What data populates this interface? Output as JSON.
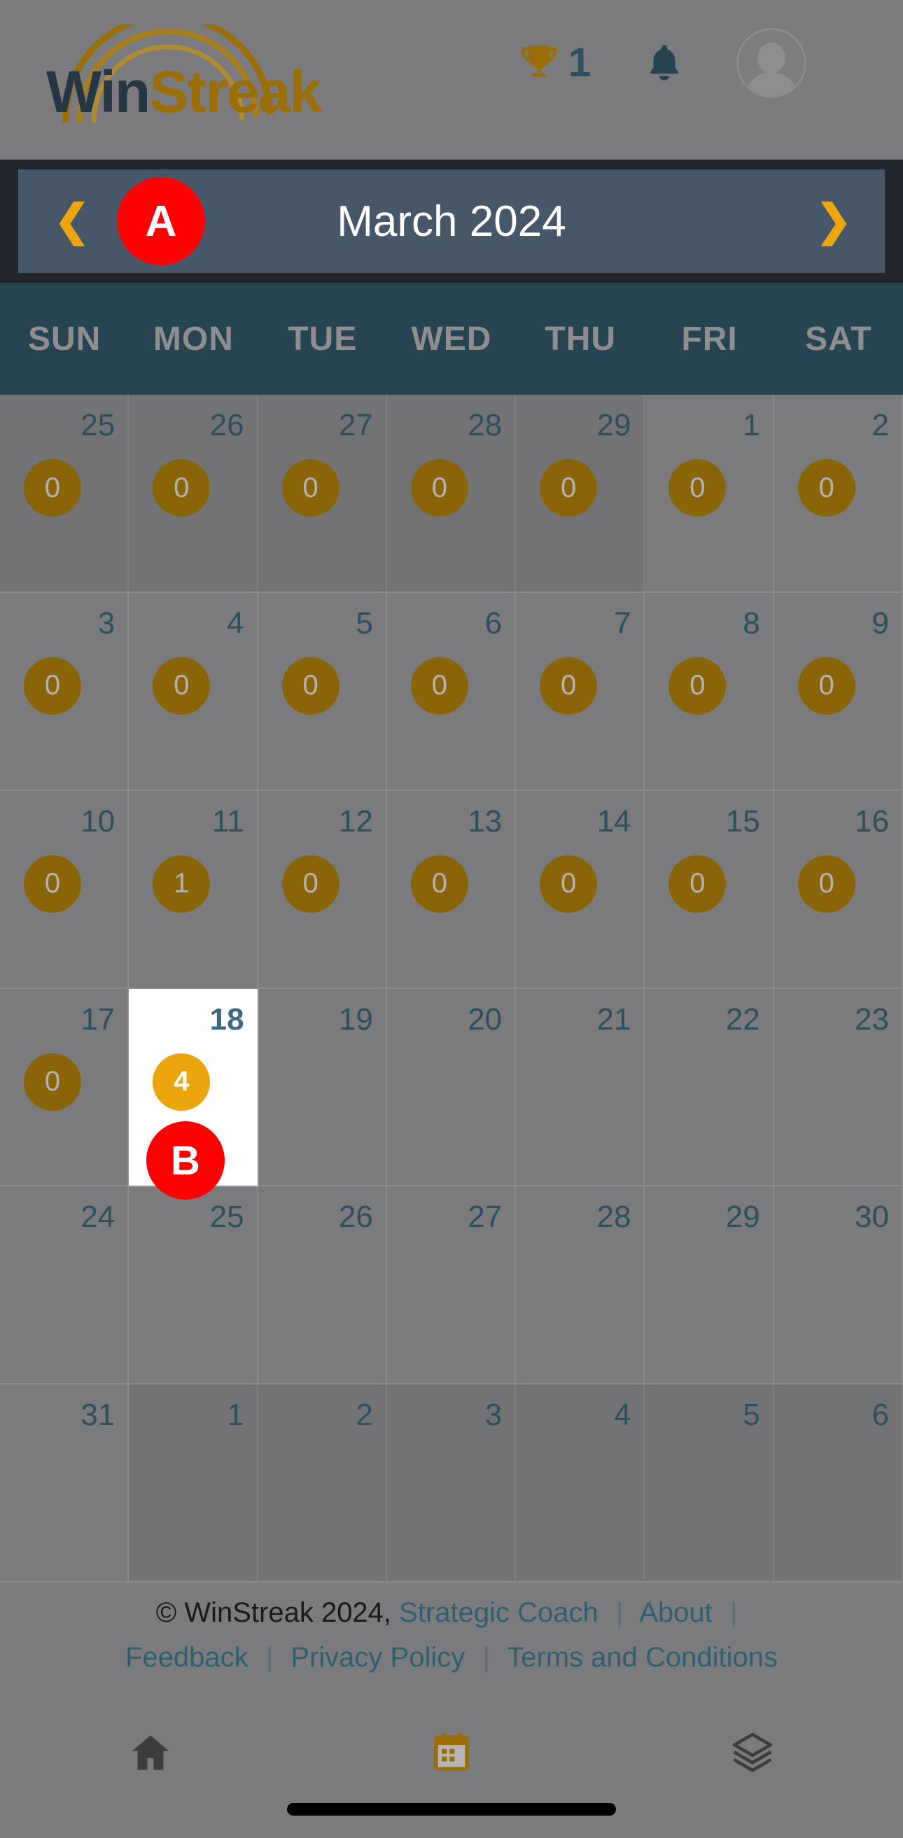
{
  "app": {
    "logo_win": "Win",
    "logo_streak": "Streak",
    "brand_dark": "#253745",
    "brand_gold": "#9a6d05"
  },
  "header": {
    "trophy_icon": "trophy-icon",
    "trophy_count": "1",
    "bell_icon": "bell-icon",
    "avatar_icon": "avatar-icon"
  },
  "month_nav": {
    "prev_label": "❮",
    "next_label": "❯",
    "title": "March 2024",
    "accent": "#eda50e",
    "panel_bg": "#46576a"
  },
  "weekdays": [
    "SUN",
    "MON",
    "TUE",
    "WED",
    "THU",
    "FRI",
    "SAT"
  ],
  "calendar": {
    "selected_day": "18",
    "badge_color": "#8a6508",
    "selected_badge_color": "#eda50e",
    "days": [
      {
        "num": "25",
        "badge": "0",
        "month": "prev"
      },
      {
        "num": "26",
        "badge": "0",
        "month": "prev"
      },
      {
        "num": "27",
        "badge": "0",
        "month": "prev"
      },
      {
        "num": "28",
        "badge": "0",
        "month": "prev"
      },
      {
        "num": "29",
        "badge": "0",
        "month": "prev"
      },
      {
        "num": "1",
        "badge": "0",
        "month": "current"
      },
      {
        "num": "2",
        "badge": "0",
        "month": "current"
      },
      {
        "num": "3",
        "badge": "0",
        "month": "current"
      },
      {
        "num": "4",
        "badge": "0",
        "month": "current"
      },
      {
        "num": "5",
        "badge": "0",
        "month": "current"
      },
      {
        "num": "6",
        "badge": "0",
        "month": "current"
      },
      {
        "num": "7",
        "badge": "0",
        "month": "current"
      },
      {
        "num": "8",
        "badge": "0",
        "month": "current"
      },
      {
        "num": "9",
        "badge": "0",
        "month": "current"
      },
      {
        "num": "10",
        "badge": "0",
        "month": "current"
      },
      {
        "num": "11",
        "badge": "1",
        "month": "current"
      },
      {
        "num": "12",
        "badge": "0",
        "month": "current"
      },
      {
        "num": "13",
        "badge": "0",
        "month": "current"
      },
      {
        "num": "14",
        "badge": "0",
        "month": "current"
      },
      {
        "num": "15",
        "badge": "0",
        "month": "current"
      },
      {
        "num": "16",
        "badge": "0",
        "month": "current"
      },
      {
        "num": "17",
        "badge": "0",
        "month": "current"
      },
      {
        "num": "18",
        "badge": "4",
        "month": "current",
        "selected": true
      },
      {
        "num": "19",
        "badge": null,
        "month": "current"
      },
      {
        "num": "20",
        "badge": null,
        "month": "current"
      },
      {
        "num": "21",
        "badge": null,
        "month": "current"
      },
      {
        "num": "22",
        "badge": null,
        "month": "current"
      },
      {
        "num": "23",
        "badge": null,
        "month": "current"
      },
      {
        "num": "24",
        "badge": null,
        "month": "current"
      },
      {
        "num": "25",
        "badge": null,
        "month": "current"
      },
      {
        "num": "26",
        "badge": null,
        "month": "current"
      },
      {
        "num": "27",
        "badge": null,
        "month": "current"
      },
      {
        "num": "28",
        "badge": null,
        "month": "current"
      },
      {
        "num": "29",
        "badge": null,
        "month": "current"
      },
      {
        "num": "30",
        "badge": null,
        "month": "current"
      },
      {
        "num": "31",
        "badge": null,
        "month": "current"
      },
      {
        "num": "1",
        "badge": null,
        "month": "next"
      },
      {
        "num": "2",
        "badge": null,
        "month": "next"
      },
      {
        "num": "3",
        "badge": null,
        "month": "next"
      },
      {
        "num": "4",
        "badge": null,
        "month": "next"
      },
      {
        "num": "5",
        "badge": null,
        "month": "next"
      },
      {
        "num": "6",
        "badge": null,
        "month": "next"
      }
    ]
  },
  "markers": [
    {
      "id": "A",
      "label": "A",
      "color": "#fe0000"
    },
    {
      "id": "B",
      "label": "B",
      "color": "#fe0000"
    }
  ],
  "footer": {
    "copyright": "© WinStreak 2024,",
    "links_line1": [
      {
        "label": "Strategic Coach"
      },
      {
        "label": "About"
      }
    ],
    "links_line2": [
      {
        "label": "Feedback"
      },
      {
        "label": "Privacy Policy"
      },
      {
        "label": "Terms and Conditions"
      }
    ],
    "separator": "|"
  },
  "bottom_nav": {
    "items": [
      {
        "icon": "home-icon",
        "active": false
      },
      {
        "icon": "calendar-icon",
        "active": true
      },
      {
        "icon": "layers-icon",
        "active": false
      }
    ],
    "active_color": "#9a6d05",
    "inactive_color": "#3d3d3d"
  }
}
